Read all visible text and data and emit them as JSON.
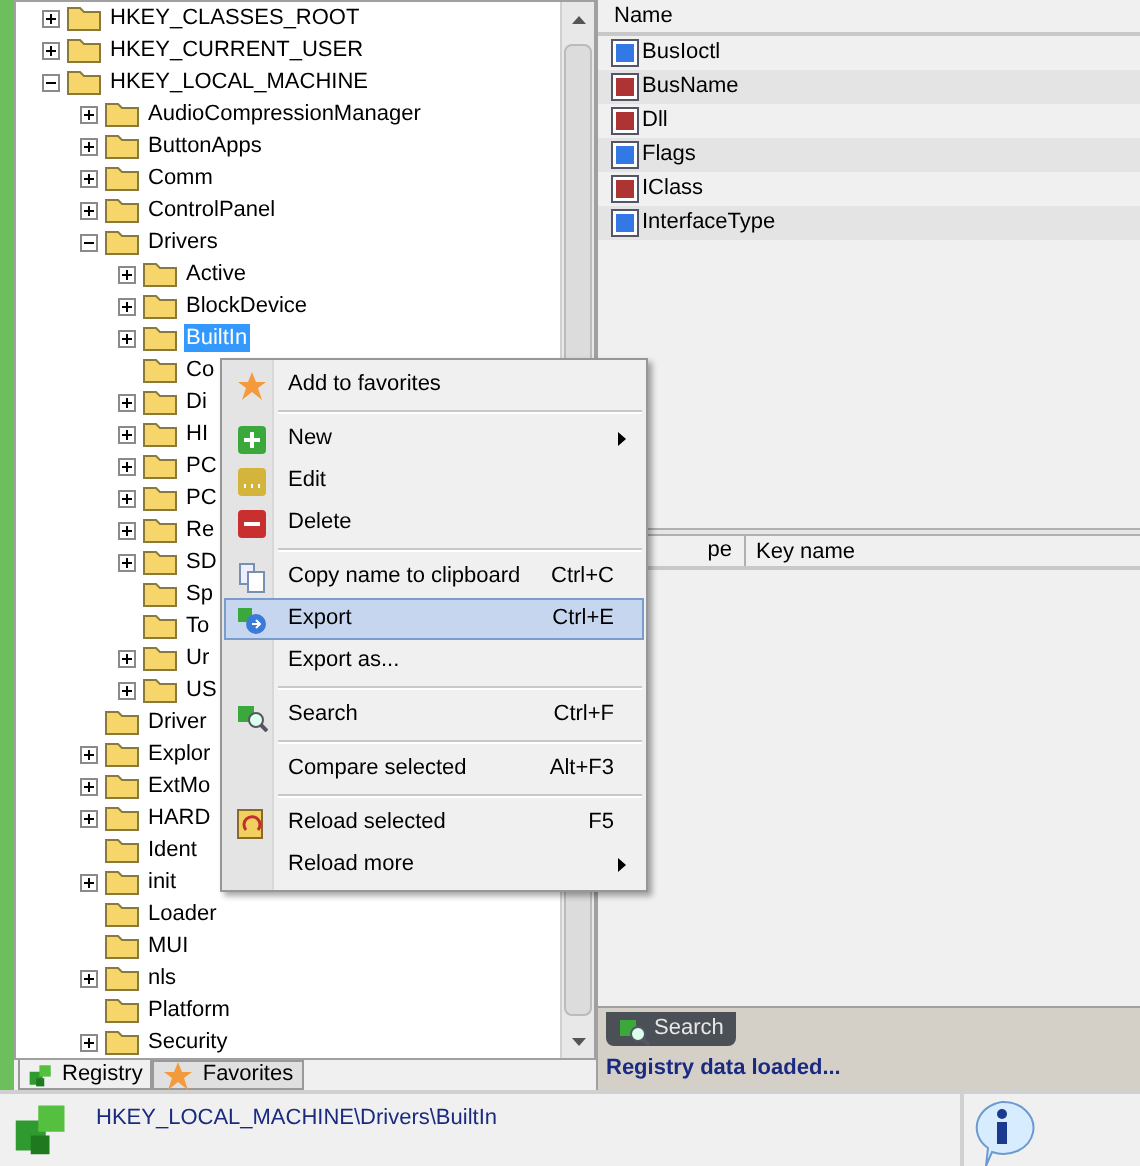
{
  "tree": [
    {
      "label": "HKEY_CLASSES_ROOT",
      "expanded": false,
      "selected": false
    },
    {
      "label": "HKEY_CURRENT_USER",
      "expanded": false,
      "selected": false
    },
    {
      "label": "HKEY_LOCAL_MACHINE",
      "expanded": true,
      "selected": false,
      "children": [
        {
          "label": "AudioCompressionManager",
          "expanded": false,
          "selected": false
        },
        {
          "label": "ButtonApps",
          "expanded": false,
          "selected": false
        },
        {
          "label": "Comm",
          "expanded": false,
          "selected": false
        },
        {
          "label": "ControlPanel",
          "expanded": false,
          "selected": false
        },
        {
          "label": "Drivers",
          "expanded": true,
          "selected": false,
          "children": [
            {
              "label": "Active",
              "expanded": false,
              "selected": false
            },
            {
              "label": "BlockDevice",
              "expanded": false,
              "selected": false
            },
            {
              "label": "BuiltIn",
              "expanded": false,
              "selected": true
            },
            {
              "label": "Co",
              "selected": false
            },
            {
              "label": "Di",
              "expanded": false,
              "selected": false
            },
            {
              "label": "HI",
              "expanded": false,
              "selected": false
            },
            {
              "label": "PC",
              "expanded": false,
              "selected": false
            },
            {
              "label": "PC",
              "expanded": false,
              "selected": false
            },
            {
              "label": "Re",
              "expanded": false,
              "selected": false
            },
            {
              "label": "SD",
              "expanded": false,
              "selected": false
            },
            {
              "label": "Sp",
              "selected": false
            },
            {
              "label": "To",
              "selected": false
            },
            {
              "label": "Ur",
              "expanded": false,
              "selected": false
            },
            {
              "label": "US",
              "expanded": false,
              "selected": false
            }
          ]
        },
        {
          "label": "Driver",
          "selected": false
        },
        {
          "label": "Explor",
          "expanded": false,
          "selected": false
        },
        {
          "label": "ExtMo",
          "expanded": false,
          "selected": false
        },
        {
          "label": "HARD",
          "expanded": false,
          "selected": false
        },
        {
          "label": "Ident",
          "selected": false
        },
        {
          "label": "init",
          "expanded": false,
          "selected": false
        },
        {
          "label": "Loader",
          "selected": false
        },
        {
          "label": "MUI",
          "selected": false
        },
        {
          "label": "nls",
          "expanded": false,
          "selected": false
        },
        {
          "label": "Platform",
          "selected": false
        },
        {
          "label": "Security",
          "expanded": false,
          "selected": false
        }
      ]
    }
  ],
  "left_tabs": [
    {
      "label": "Registry",
      "selected": true
    },
    {
      "label": "Favorites",
      "selected": false
    }
  ],
  "values_list": {
    "column": "Name",
    "rows": [
      {
        "name": "BusIoctl",
        "kind": "dword"
      },
      {
        "name": "BusName",
        "kind": "string"
      },
      {
        "name": "Dll",
        "kind": "string"
      },
      {
        "name": "Flags",
        "kind": "dword"
      },
      {
        "name": "IClass",
        "kind": "multi"
      },
      {
        "name": "InterfaceType",
        "kind": "dword"
      }
    ]
  },
  "search_results": {
    "columns": [
      "pe",
      "Key name"
    ]
  },
  "search_tab": {
    "label": "Search"
  },
  "message": "Registry data loaded...",
  "status_bar": {
    "path": "HKEY_LOCAL_MACHINE\\Drivers\\BuiltIn"
  },
  "context_menu": [
    {
      "kind": "favorite",
      "label": "Add to favorites",
      "selected": false
    },
    {
      "kind": "separator"
    },
    {
      "kind": "new",
      "label": "New",
      "submenu": true,
      "selected": false
    },
    {
      "kind": "edit",
      "label": "Edit",
      "selected": false
    },
    {
      "kind": "delete",
      "label": "Delete",
      "selected": false
    },
    {
      "kind": "separator"
    },
    {
      "kind": "copy",
      "label": "Copy name to clipboard",
      "shortcut": "Ctrl+C",
      "selected": false
    },
    {
      "kind": "export",
      "label": "Export",
      "shortcut": "Ctrl+E",
      "selected": true
    },
    {
      "kind": "plain",
      "label": "Export as...",
      "selected": false
    },
    {
      "kind": "separator"
    },
    {
      "kind": "search",
      "label": "Search",
      "shortcut": "Ctrl+F",
      "selected": false
    },
    {
      "kind": "separator"
    },
    {
      "kind": "plain",
      "label": "Compare selected",
      "shortcut": "Alt+F3",
      "selected": false
    },
    {
      "kind": "separator"
    },
    {
      "kind": "reload",
      "label": "Reload selected",
      "shortcut": "F5",
      "selected": false
    },
    {
      "kind": "plain",
      "label": "Reload more",
      "submenu": true,
      "selected": false
    }
  ]
}
